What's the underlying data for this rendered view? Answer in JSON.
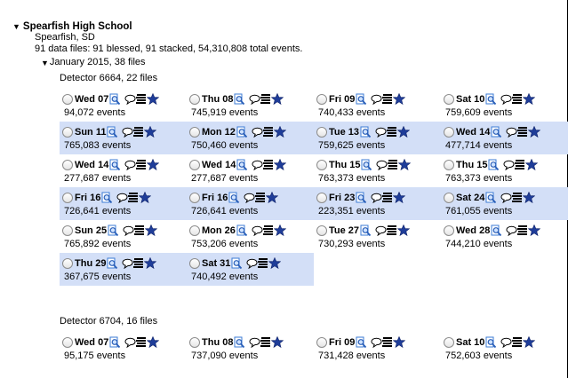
{
  "school": {
    "name": "Spearfish High School",
    "city": "Spearfish, SD",
    "summary": "91 data files: 91 blessed, 91 stacked, 54,310,808 total events."
  },
  "month": {
    "label": "January 2015, 38 files"
  },
  "detectors": [
    {
      "label": "Detector 6664, 22 files",
      "rows": [
        [
          {
            "day": "Wed 07",
            "events": "94,072 events"
          },
          {
            "day": "Thu 08",
            "events": "745,919 events"
          },
          {
            "day": "Fri 09",
            "events": "740,433 events"
          },
          {
            "day": "Sat 10",
            "events": "759,609 events"
          }
        ],
        [
          {
            "day": "Sun 11",
            "events": "765,083 events"
          },
          {
            "day": "Mon 12",
            "events": "750,460 events"
          },
          {
            "day": "Tue 13",
            "events": "759,625 events"
          },
          {
            "day": "Wed 14",
            "events": "477,714 events"
          }
        ],
        [
          {
            "day": "Wed 14",
            "events": "277,687 events"
          },
          {
            "day": "Wed 14",
            "events": "277,687 events"
          },
          {
            "day": "Thu 15",
            "events": "763,373 events"
          },
          {
            "day": "Thu 15",
            "events": "763,373 events"
          }
        ],
        [
          {
            "day": "Fri 16",
            "events": "726,641 events"
          },
          {
            "day": "Fri 16",
            "events": "726,641 events"
          },
          {
            "day": "Fri 23",
            "events": "223,351 events"
          },
          {
            "day": "Sat 24",
            "events": "761,055 events"
          }
        ],
        [
          {
            "day": "Sun 25",
            "events": "765,892 events"
          },
          {
            "day": "Mon 26",
            "events": "753,206 events"
          },
          {
            "day": "Tue 27",
            "events": "730,293 events"
          },
          {
            "day": "Wed 28",
            "events": "744,210 events"
          }
        ],
        [
          {
            "day": "Thu 29",
            "events": "367,675 events"
          },
          {
            "day": "Sat 31",
            "events": "740,492 events"
          }
        ]
      ]
    },
    {
      "label": "Detector 6704, 16 files",
      "rows": [
        [
          {
            "day": "Wed 07",
            "events": "95,175 events"
          },
          {
            "day": "Thu 08",
            "events": "737,090 events"
          },
          {
            "day": "Fri 09",
            "events": "731,428 events"
          },
          {
            "day": "Sat 10",
            "events": "752,603 events"
          }
        ]
      ]
    }
  ],
  "icons": [
    "magnifier-doc-icon",
    "comment-bubble-icon",
    "stack-lines-icon",
    "star-icon"
  ],
  "colors": {
    "shade": "#d3dff7",
    "icon_blue": "#1f3d99",
    "magnifier": "#3b7bd6"
  }
}
